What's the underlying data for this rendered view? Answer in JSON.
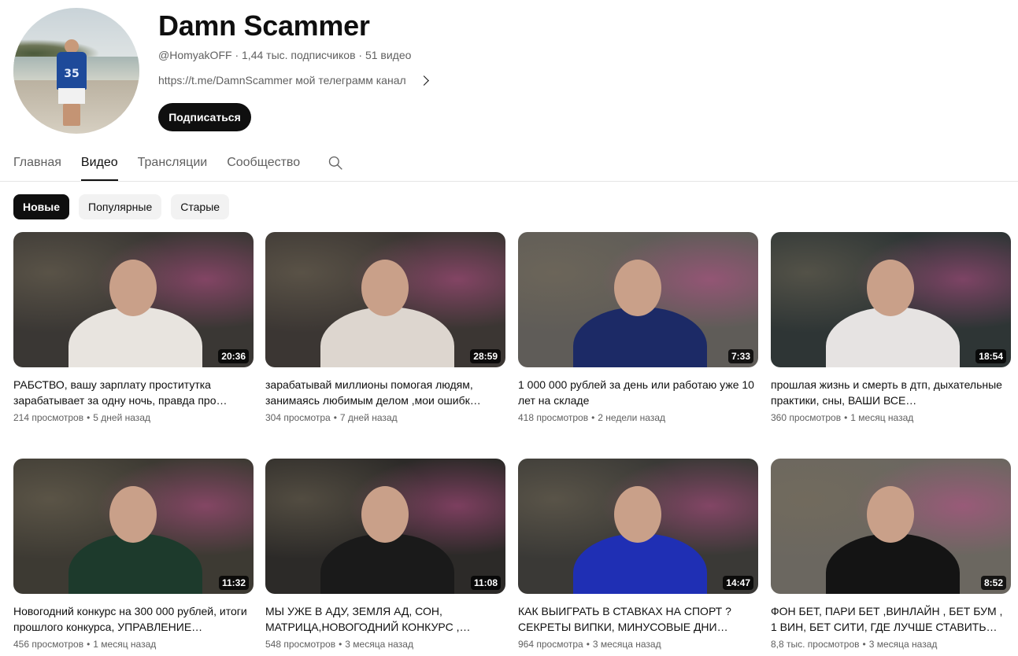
{
  "channel": {
    "name": "Damn Scammer",
    "handle": "@HomyakOFF",
    "subscribers": "1,44 тыс. подписчиков",
    "video_count": "51 видео",
    "meta_sep": " · ",
    "description": "https://t.me/DamnScammer мой телеграмм канал",
    "jersey_number": "35",
    "subscribe_label": "Подписаться"
  },
  "tabs": [
    {
      "label": "Главная",
      "active": false
    },
    {
      "label": "Видео",
      "active": true
    },
    {
      "label": "Трансляции",
      "active": false
    },
    {
      "label": "Сообщество",
      "active": false
    }
  ],
  "chips": [
    {
      "label": "Новые",
      "active": true
    },
    {
      "label": "Популярные",
      "active": false
    },
    {
      "label": "Старые",
      "active": false
    }
  ],
  "videos": [
    {
      "title": "РАБСТВО, вашу зарплату проститутка зарабатывает за одну ночь, правда про…",
      "views": "214 просмотров",
      "age": "5 дней назад",
      "duration": "20:36",
      "bg": "#3a3734",
      "shirt": "#e8e4df"
    },
    {
      "title": "зарабатывай миллионы помогая людям, занимаясь любимым делом ,мои ошибк…",
      "views": "304 просмотра",
      "age": "7 дней назад",
      "duration": "28:59",
      "bg": "#3b3633",
      "shirt": "#ddd6cf"
    },
    {
      "title": "1 000 000 рублей за день или работаю уже 10 лет на складе",
      "views": "418 просмотров",
      "age": "2 недели назад",
      "duration": "7:33",
      "bg": "#5f5c58",
      "shirt": "#1c2a66"
    },
    {
      "title": "прошлая жизнь и смерть в дтп, дыхательные практики, сны, ВАШИ ВСЕ…",
      "views": "360 просмотров",
      "age": "1 месяц назад",
      "duration": "18:54",
      "bg": "#2e3535",
      "shirt": "#e6e3e2"
    },
    {
      "title": "Новогодний конкурс на 300 000 рублей, итоги прошлого конкурса, УПРАВЛЕНИЕ…",
      "views": "456 просмотров",
      "age": "1 месяц назад",
      "duration": "11:32",
      "bg": "#3d3a33",
      "shirt": "#1d3a2c"
    },
    {
      "title": "МЫ УЖЕ В АДУ, ЗЕМЛЯ АД, СОН, МАТРИЦА,НОВОГОДНИЙ КОНКУРС ,…",
      "views": "548 просмотров",
      "age": "3 месяца назад",
      "duration": "11:08",
      "bg": "#2c2a28",
      "shirt": "#1a1a1a"
    },
    {
      "title": "КАК ВЫИГРАТЬ В СТАВКАХ НА СПОРТ ? СЕКРЕТЫ ВИПКИ, МИНУСОВЫЕ ДНИ…",
      "views": "964 просмотра",
      "age": "3 месяца назад",
      "duration": "14:47",
      "bg": "#3a3936",
      "shirt": "#1f2fb4"
    },
    {
      "title": "ФОН БЕТ, ПАРИ БЕТ ,ВИНЛАЙН , БЕТ БУМ , 1 ВИН, БЕТ СИТИ, ГДЕ ЛУЧШЕ СТАВИТЬ…",
      "views": "8,8 тыс. просмотров",
      "age": "3 месяца назад",
      "duration": "8:52",
      "bg": "#6b6760",
      "shirt": "#141414"
    }
  ],
  "stats_sep": "•",
  "icons": {
    "search": "search-icon",
    "chevron": "chevron-right-icon"
  }
}
